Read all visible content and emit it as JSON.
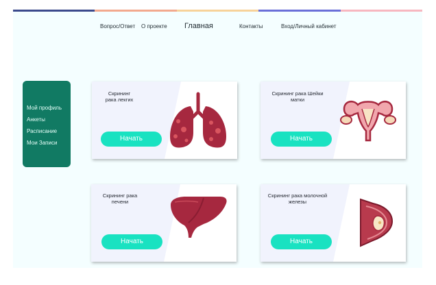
{
  "colors": {
    "page_bg": "#f4feff",
    "sidebar_bg": "#117a63",
    "button_bg": "#19e2c1",
    "organ_red": "#a6283f",
    "topline": [
      "#3b4a8c",
      "#f2a98e",
      "#f7d29a",
      "#6a6fd8",
      "#f7b7c0"
    ]
  },
  "nav": {
    "items": [
      {
        "label": "Вопрос/Ответ"
      },
      {
        "label": "О проекте"
      },
      {
        "label": "Главная"
      },
      {
        "label": "Контакты"
      },
      {
        "label": "Вход/Личный кабинет"
      }
    ]
  },
  "sidebar": {
    "items": [
      {
        "label": "Мой профиль"
      },
      {
        "label": "Анкеты"
      },
      {
        "label": "Расписание"
      },
      {
        "label": "Мои Записи"
      }
    ]
  },
  "cards": [
    {
      "title_lines": [
        "Скрининг",
        "рака лекгих"
      ],
      "button": "Начать",
      "icon": "lungs-icon"
    },
    {
      "title_lines": [
        "Скрининг рака Шейки",
        "матки"
      ],
      "button": "Начать",
      "icon": "uterus-icon"
    },
    {
      "title_lines": [
        "Скрининг рака",
        "печени"
      ],
      "button": "Начать",
      "icon": "liver-icon"
    },
    {
      "title_lines": [
        "Скрининг рака молочной",
        "железы"
      ],
      "button": "Начать",
      "icon": "breast-icon"
    }
  ]
}
